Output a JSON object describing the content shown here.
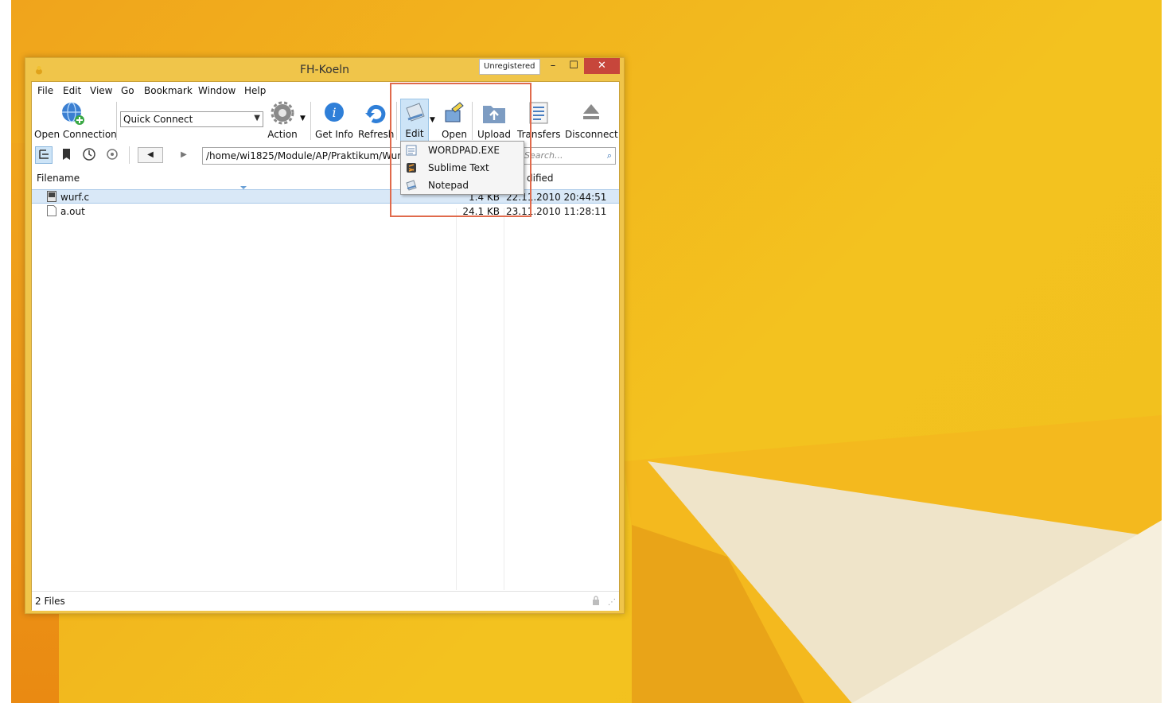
{
  "window": {
    "title": "FH-Koeln",
    "badge": "Unregistered",
    "minimize_glyph": "–",
    "maximize_glyph": "☐",
    "close_glyph": "✕"
  },
  "menu": [
    "File",
    "Edit",
    "View",
    "Go",
    "Bookmark",
    "Window",
    "Help"
  ],
  "toolbar": {
    "open_connection": "Open Connection",
    "quick_connect": "Quick Connect",
    "action": "Action",
    "get_info": "Get Info",
    "refresh": "Refresh",
    "edit": "Edit",
    "open": "Open",
    "upload": "Upload",
    "transfers": "Transfers",
    "disconnect": "Disconnect"
  },
  "nav": {
    "back_glyph": "◀",
    "forward_glyph": "▶",
    "path": "/home/wi1825/Module/AP/Praktikum/Wurf",
    "search_placeholder": "Search..."
  },
  "columns": {
    "filename": "Filename",
    "modified": "dified"
  },
  "files": [
    {
      "name": "wurf.c",
      "size": "1.4 KB",
      "modified": "22.11.2010 20:44:51",
      "selected": true
    },
    {
      "name": "a.out",
      "size": "24.1 KB",
      "modified": "23.11.2010 11:28:11",
      "selected": false
    }
  ],
  "status": "2 Files",
  "edit_menu": [
    "WORDPAD.EXE",
    "Sublime Text",
    "Notepad"
  ],
  "colors": {
    "window_frame": "#f0c54a",
    "close_button": "#c7463b",
    "selection": "#d9e8f7",
    "highlight_box": "#e06a4c"
  }
}
